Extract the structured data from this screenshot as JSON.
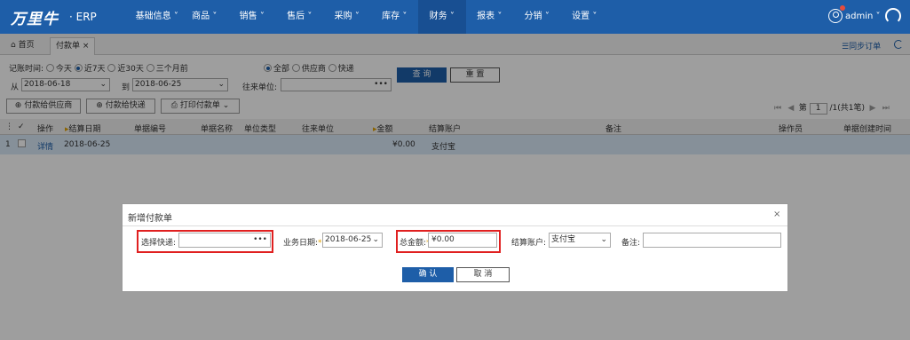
{
  "app": {
    "logo": "万里牛",
    "suffix": "· ERP"
  },
  "nav": [
    {
      "label": "基础信息 ˅"
    },
    {
      "label": "商品 ˅"
    },
    {
      "label": "销售 ˅"
    },
    {
      "label": "售后 ˅"
    },
    {
      "label": "采购 ˅"
    },
    {
      "label": "库存 ˅"
    },
    {
      "label": "财务 ˅",
      "active": true
    },
    {
      "label": "报表 ˅"
    },
    {
      "label": "分销 ˅"
    },
    {
      "label": "设置 ˅"
    }
  ],
  "user": {
    "name": "admin ˅"
  },
  "tabs": [
    {
      "label": "首页"
    },
    {
      "label": "付款单",
      "close": "×"
    }
  ],
  "tab_actions": {
    "sync": "☰同步订单"
  },
  "filters": {
    "record_time_label": "记账时间:",
    "time_options": [
      "今天",
      "近7天",
      "近30天",
      "三个月前"
    ],
    "scope_options": [
      "全部",
      "供应商",
      "快递"
    ],
    "from_label": "从",
    "from_date": "2018-06-18",
    "to_label": "到",
    "to_date": "2018-06-25",
    "partner_label": "往来单位:",
    "query": "查 询",
    "reset": "重 置"
  },
  "toolbar": {
    "pay_supplier": "付款给供应商",
    "pay_express": "付款给快递",
    "print": "打印付款单"
  },
  "pager": {
    "prefix": "第",
    "page": "1",
    "suffix": "/1(共1笔)"
  },
  "table": {
    "headers": [
      "操作",
      "结算日期",
      "单据编号",
      "单据名称",
      "单位类型",
      "往来单位",
      "金额",
      "结算账户",
      "备注",
      "操作员",
      "单据创建时间"
    ],
    "rows": [
      {
        "index": "1",
        "action": "详情",
        "date": "2018-06-25",
        "amount": "¥0.00",
        "account": "支付宝"
      }
    ]
  },
  "dialog": {
    "title": "新增付款单",
    "close": "×",
    "express_label": "选择快递:",
    "express_value": "",
    "biz_date_label": "业务日期:",
    "biz_date": "2018-06-25",
    "total_label": "总金额:",
    "total": "¥0.00",
    "account_label": "结算账户:",
    "account": "支付宝",
    "remark_label": "备注:",
    "remark": "",
    "ok": "确 认",
    "cancel": "取 消"
  }
}
